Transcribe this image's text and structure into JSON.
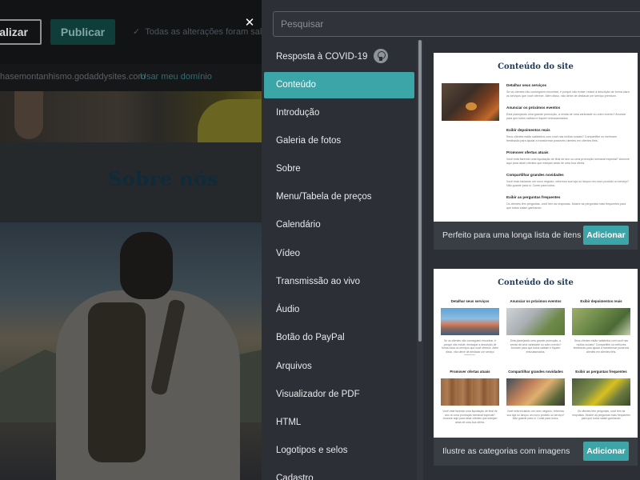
{
  "editor": {
    "preview_button_label": "ualizar",
    "publish_button_label": "Publicar",
    "saved_status": "Todas as alterações foram salvas",
    "site_url": "hasemontanhismo.godaddysites.com",
    "use_domain_link": "Usar meu domínio",
    "section_title": "Sobre nós"
  },
  "dialog": {
    "close_glyph": "✕",
    "search": {
      "placeholder": "Pesquisar",
      "value": ""
    },
    "sections": [
      {
        "label": "Resposta à COVID-19",
        "badge": "ribbon-icon"
      },
      {
        "label": "Conteúdo",
        "active": true
      },
      {
        "label": "Introdução"
      },
      {
        "label": "Galeria de fotos"
      },
      {
        "label": "Sobre"
      },
      {
        "label": "Menu/Tabela de preços"
      },
      {
        "label": "Calendário"
      },
      {
        "label": "Vídeo"
      },
      {
        "label": "Transmissão ao vivo"
      },
      {
        "label": "Áudio"
      },
      {
        "label": "Botão do PayPal"
      },
      {
        "label": "Arquivos"
      },
      {
        "label": "Visualizador de PDF"
      },
      {
        "label": "HTML"
      },
      {
        "label": "Logotipos e selos"
      },
      {
        "label": "Cadastro"
      }
    ],
    "layouts": [
      {
        "preview_title": "Conteúdo do site",
        "items": [
          {
            "heading": "Detalhar seus serviços",
            "text": "Se os clientes não conseguem encontrar, é porque não existe: realce a descrição de forma clara os serviços que você oferece. Além disso, não deixe de destacar um serviço premium."
          },
          {
            "heading": "Anunciar os próximos eventos",
            "text": "Está planejando uma grande promoção, a venda de uma variedade ou outro evento? Anuncie para que todos saibam e fiquem entusiasmados."
          },
          {
            "heading": "Exibir depoimentos reais",
            "text": "Seus clientes estão satisfeitos com você nas mídias sociais? Compartilhe os melhores feedbacks para ajudar a transformar possíveis clientes em clientes fiéis."
          },
          {
            "heading": "Promover ofertas atuais",
            "text": "Você está fazendo uma liquidação de final de ano ou uma promoção semanal especial? Anuncie aqui para atrair clientes que estejam atrás de uma boa oferta."
          },
          {
            "heading": "Compartilhar grandes novidades",
            "text": "Você está iniciando um novo negócio, reformou sua loja ou lançou um novo produto ou serviço? Não guarde para si. Conte para todos."
          },
          {
            "heading": "Exibir as perguntas frequentes",
            "text": "Os clientes têm perguntas, você tem as respostas. Mostre as perguntas mais frequentes para que todos saiam ganhando."
          }
        ],
        "description": "Perfeito para uma longa lista de itens",
        "add_label": "Adicionar"
      },
      {
        "preview_title": "Conteúdo do site",
        "items": [
          {
            "heading": "Detalhar seus serviços",
            "text": "Se os clientes não conseguem encontrar, é porque não existe: destaque a descrição de forma clara os serviços que você oferece. Além disso, não deixe de destacar um serviço premium.",
            "image": "mountain-photo"
          },
          {
            "heading": "Anunciar os próximos eventos",
            "text": "Está planejando uma grande promoção, a venda de uma variedade ou outro evento? Anuncie para que todos saibam e fiquem entusiasmados.",
            "image": "car-photo"
          },
          {
            "heading": "Exibir depoimentos reais",
            "text": "Seus clientes estão satisfeitos com você nas mídias sociais? Compartilhe os melhores feedbacks para ajudar a transformar possíveis clientes em clientes fiéis.",
            "image": "field-photo"
          },
          {
            "heading": "Promover ofertas atuais",
            "text": "Você está fazendo uma liquidação de final de ano ou uma promoção semanal especial? Anuncie aqui para atrair clientes que estejam atrás de uma boa oferta.",
            "image": "wood-photo"
          },
          {
            "heading": "Compartilhar grandes novidades",
            "text": "Você está iniciando um novo negócio, reformou sua loja ou lançou um novo produto ou serviço? Não guarde para si. Conte para todos.",
            "image": "food-photo"
          },
          {
            "heading": "Exibir as perguntas frequentes",
            "text": "Os clientes têm perguntas, você tem as respostas. Mostre as perguntas mais frequentes para que todos saiam ganhando.",
            "image": "camp-photo"
          }
        ],
        "description": "Ilustre as categorias com imagens",
        "add_label": "Adicionar"
      }
    ]
  },
  "colors": {
    "accent": "#3ba5a7",
    "dialog_bg": "#2c2f36",
    "footer_bg": "#393d44",
    "title_blue": "#1e3a5a"
  }
}
